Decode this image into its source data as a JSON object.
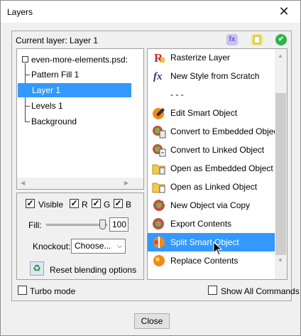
{
  "window": {
    "title": "Layers",
    "close_glyph": "✕"
  },
  "header": {
    "current_layer": "Current layer: Layer 1",
    "icons": [
      {
        "name": "fx-icon",
        "glyph": "fx",
        "bg": "#b9b4e6",
        "color": "#6a5fc0"
      },
      {
        "name": "smart-object-icon",
        "glyph": "▪",
        "bg": "#f3e36a",
        "color": "#9a8a10"
      },
      {
        "name": "check-icon",
        "glyph": "✔",
        "bg": "#2fb34a",
        "color": "#ffffff"
      }
    ]
  },
  "tree": {
    "root": "even-more-elements.psd:",
    "items": [
      "Pattern Fill 1",
      "Layer 1",
      "Levels 1",
      "Background"
    ],
    "selected_index": 1
  },
  "options": {
    "visible_label": "Visible",
    "channels": [
      "R",
      "G",
      "B"
    ],
    "fill_label": "Fill:",
    "fill_value": "100",
    "fill_level": 1.0,
    "knockout_label": "Knockout:",
    "knockout_value": "Choose...",
    "reset_label": "Reset blending options"
  },
  "commands": {
    "items": [
      {
        "label": "Rasterize Layer",
        "icon": "rasterize-icon"
      },
      {
        "label": "New Style from Scratch",
        "icon": "fx-style-icon"
      },
      {
        "label": "- - -",
        "icon": ""
      },
      {
        "label": "Edit Smart Object",
        "icon": "edit-smart-object-icon"
      },
      {
        "label": "Convert to Embedded Object",
        "icon": "convert-embedded-icon"
      },
      {
        "label": "Convert to Linked Object",
        "icon": "convert-linked-icon"
      },
      {
        "label": "Open as Embedded Object",
        "icon": "open-embedded-icon"
      },
      {
        "label": "Open as Linked Object",
        "icon": "open-linked-icon"
      },
      {
        "label": "New Object via Copy",
        "icon": "new-object-copy-icon"
      },
      {
        "label": "Export Contents",
        "icon": "export-contents-icon"
      },
      {
        "label": "Split Smart Object",
        "icon": "split-smart-object-icon"
      },
      {
        "label": "Replace Contents",
        "icon": "replace-contents-icon"
      }
    ],
    "selected_index": 10
  },
  "footer": {
    "turbo_label": "Turbo mode",
    "show_all_label": "Show All Commands",
    "close_label": "Close"
  },
  "colors": {
    "selection": "#3399ff"
  }
}
